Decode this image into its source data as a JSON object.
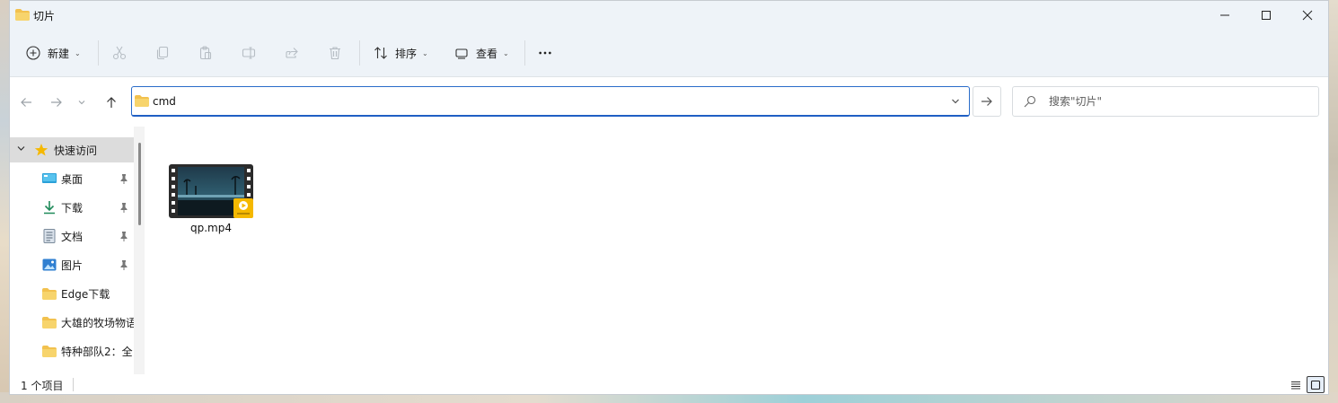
{
  "window": {
    "title": "切片",
    "controls": {
      "minimize": "—",
      "maximize": "☐",
      "close": "✕"
    }
  },
  "toolbar": {
    "new_label": "新建",
    "sort_label": "排序",
    "view_label": "查看",
    "more_label": "···",
    "icons": [
      "plus-circle-icon",
      "cut-icon",
      "copy-icon",
      "paste-icon",
      "rename-icon",
      "share-icon",
      "delete-icon",
      "sort-icon",
      "view-icon",
      "more-icon"
    ]
  },
  "address": {
    "value": "cmd",
    "search_placeholder": "搜索\"切片\""
  },
  "sidebar": {
    "items": [
      {
        "label": "快速访问",
        "icon": "star-icon",
        "pinned": false,
        "selected": true
      },
      {
        "label": "桌面",
        "icon": "desktop-icon",
        "pinned": true
      },
      {
        "label": "下载",
        "icon": "download-icon",
        "pinned": true
      },
      {
        "label": "文档",
        "icon": "document-icon",
        "pinned": true
      },
      {
        "label": "图片",
        "icon": "picture-icon",
        "pinned": true
      },
      {
        "label": "Edge下载",
        "icon": "folder-icon",
        "pinned": false
      },
      {
        "label": "大雄的牧场物语",
        "icon": "folder-icon",
        "pinned": false
      },
      {
        "label": "特种部队2：全",
        "icon": "folder-icon",
        "pinned": false
      }
    ]
  },
  "content": {
    "files": [
      {
        "name": "qp.mp4",
        "icon": "video-file-icon",
        "badge": "player"
      }
    ]
  },
  "statusbar": {
    "item_count": "1 个项目"
  },
  "colors": {
    "accent": "#1f5fc4",
    "folder": "#f2c14e",
    "chrome": "#eef3f8",
    "player_badge": "#f5b800"
  }
}
